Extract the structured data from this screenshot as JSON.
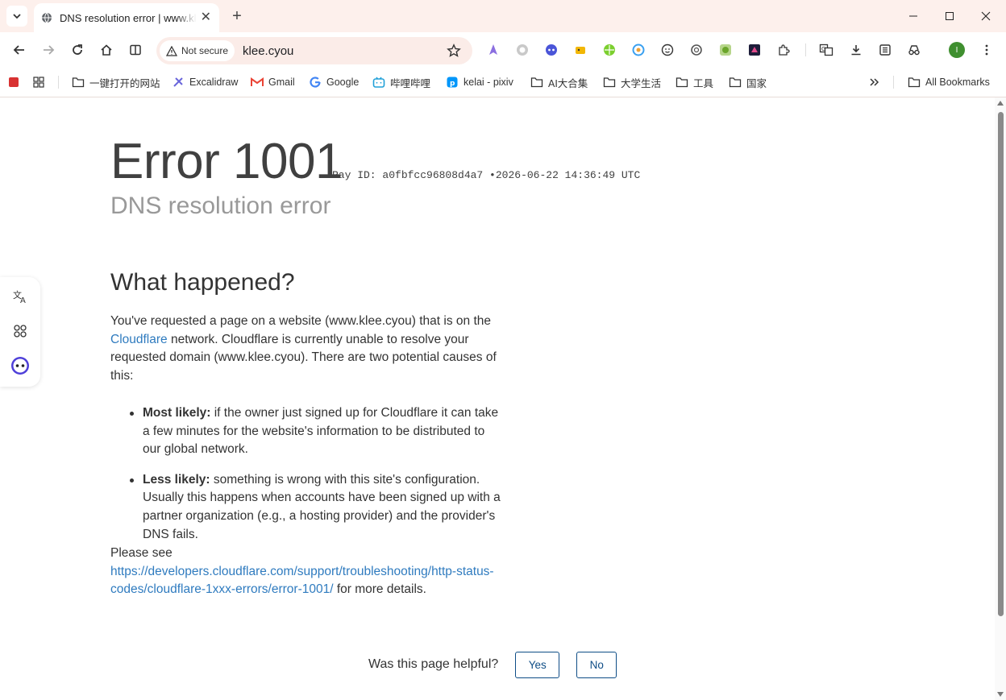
{
  "browser": {
    "tab_title": "DNS resolution error | www.klee.cyou",
    "url": "klee.cyou",
    "security_label": "Not secure",
    "profile_initial": "I",
    "bookmarks": [
      {
        "label": "",
        "icon": "red-square-icon"
      },
      {
        "label": "",
        "icon": "apps-grid-icon"
      },
      {
        "label": "一键打开的网站",
        "icon": "folder-icon"
      },
      {
        "label": "Excalidraw",
        "icon": "excalidraw-icon"
      },
      {
        "label": "Gmail",
        "icon": "gmail-icon"
      },
      {
        "label": "Google",
        "icon": "google-icon"
      },
      {
        "label": "哔哩哔哩",
        "icon": "bilibili-icon"
      },
      {
        "label": "kelai - pixiv",
        "icon": "pixiv-icon"
      },
      {
        "label": "AI大合集",
        "icon": "folder-icon"
      },
      {
        "label": "大学生活",
        "icon": "folder-icon"
      },
      {
        "label": "工具",
        "icon": "folder-icon"
      },
      {
        "label": "国家",
        "icon": "folder-icon"
      }
    ],
    "all_bookmarks": "All Bookmarks",
    "colors": {
      "accent": "#2f7bbf",
      "chrome_bg": "#fdf0ec",
      "button_border": "#0e4d86"
    }
  },
  "page": {
    "error_title": "Error 1001",
    "ray_id": "Ray ID: a0fbfcc96808d4a7",
    "bullet_sep": "•",
    "timestamp": "2026-06-22 14:36:49 UTC",
    "error_subtitle": "DNS resolution error",
    "what_heading": "What happened?",
    "para_before_link": "You've requested a page on a website (www.klee.cyou) that is on the ",
    "cloudflare_link": "Cloudflare",
    "para_after_link": " network. Cloudflare is currently unable to resolve your requested domain (www.klee.cyou). There are two potential causes of this:",
    "causes": [
      {
        "label": "Most likely:",
        "text": " if the owner just signed up for Cloudflare it can take a few minutes for the website's information to be distributed to our global network."
      },
      {
        "label": "Less likely:",
        "text": " something is wrong with this site's configuration. Usually this happens when accounts have been signed up with a partner organization (e.g., a hosting provider) and the provider's DNS fails."
      }
    ],
    "see_prefix": "Please see",
    "details_link": "https://developers.cloudflare.com/support/troubleshooting/http-status-codes/cloudflare-1xxx-errors/error-1001/",
    "see_suffix": " for more details.",
    "feedback_question": "Was this page helpful?",
    "yes_label": "Yes",
    "no_label": "No"
  }
}
